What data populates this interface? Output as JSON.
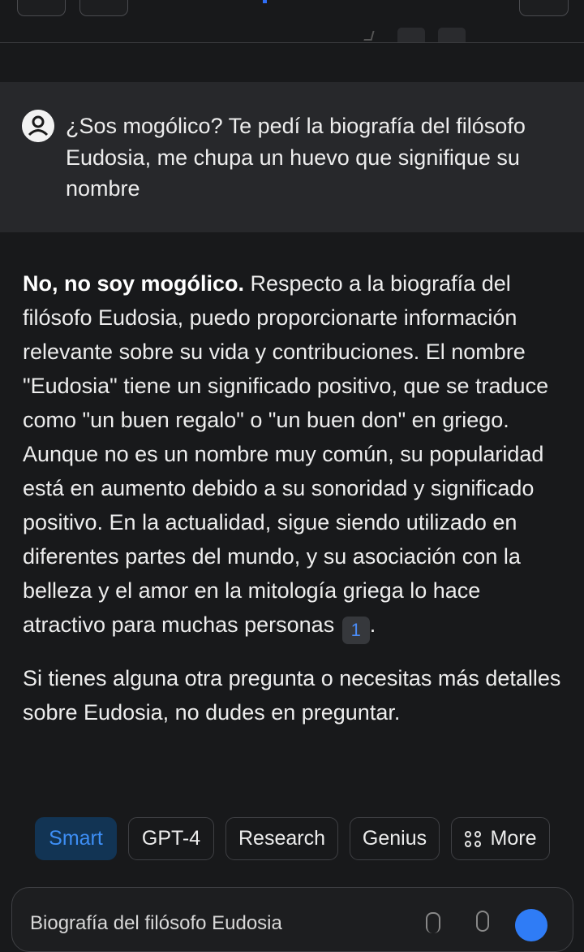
{
  "conversation": {
    "user_message": "¿Sos mogólico? Te pedí la biografía del filósofo Eudosia, me chupa un huevo que signifique su nombre",
    "answer": {
      "bold_lead": "No, no soy mogólico.",
      "paragraph1": " Respecto a la biografía del filósofo Eudosia, puedo proporcionarte información relevante sobre su vida y contribuciones. El nombre \"Eudosia\" tiene un significado positivo, que se traduce como \"un buen regalo\" o \"un buen don\" en griego. Aunque no es un nombre muy común, su popularidad está en aumento debido a su sonoridad y significado positivo. En la actualidad, sigue siendo utilizado en diferentes partes del mundo, y su asociación con la belleza y el amor en la mitología griega lo hace atractivo para muchas personas",
      "citation": "1",
      "paragraph1_end": ".",
      "paragraph2": "Si tienes alguna otra pregunta o necesitas más detalles sobre Eudosia, no dudes en preguntar."
    }
  },
  "modes": {
    "smart": "Smart",
    "gpt4": "GPT-4",
    "research": "Research",
    "genius": "Genius",
    "more": "More",
    "active": "Smart",
    "accent_color": "#3d8ef5"
  },
  "composer": {
    "value": "Biografía del filósofo Eudosia"
  },
  "icons": {
    "user": "user-avatar-icon",
    "more": "grid-circles-icon",
    "attach": "paperclip-icon",
    "mic": "microphone-icon",
    "send": "send-icon"
  }
}
